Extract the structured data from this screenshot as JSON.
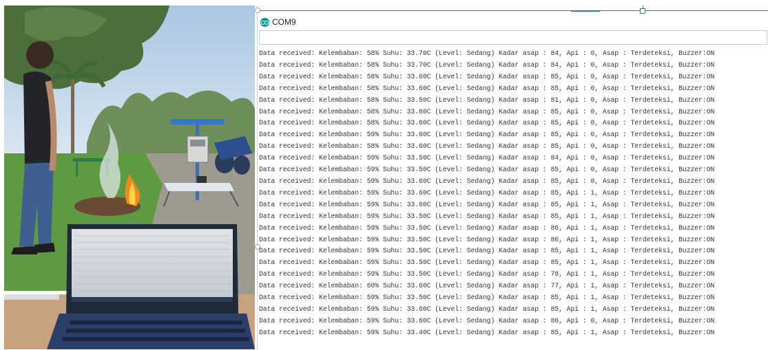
{
  "window": {
    "title": "COM9",
    "app_icon": "arduino-infinity-icon",
    "accent_color": "#00979d"
  },
  "send_input": {
    "value": "",
    "placeholder": ""
  },
  "serial_output": [
    "Data received: Kelembaban: 58% Suhu: 33.70C (Level: Sedang) Kadar asap : 84, Api : 0, Asap : Terdeteksi, Buzzer:ON",
    "Data received: Kelembaban: 58% Suhu: 33.70C (Level: Sedang) Kadar asap : 84, Api : 0, Asap : Terdeteksi, Buzzer:ON",
    "Data received: Kelembaban: 58% Suhu: 33.60C (Level: Sedang) Kadar asap : 85, Api : 0, Asap : Terdeteksi, Buzzer:ON",
    "Data received: Kelembaban: 58% Suhu: 33.60C (Level: Sedang) Kadar asap : 85, Api : 0, Asap : Terdeteksi, Buzzer:ON",
    "Data received: Kelembaban: 58% Suhu: 33.50C (Level: Sedang) Kadar asap : 81, Api : 0, Asap : Terdeteksi, Buzzer:ON",
    "Data received: Kelembaban: 58% Suhu: 33.60C (Level: Sedang) Kadar asap : 85, Api : 0, Asap : Terdeteksi, Buzzer:ON",
    "Data received: Kelembaban: 58% Suhu: 33.60C (Level: Sedang) Kadar asap : 85, Api : 0, Asap : Terdeteksi, Buzzer:ON",
    "Data received: Kelembaban: 59% Suhu: 33.60C (Level: Sedang) Kadar asap : 85, Api : 0, Asap : Terdeteksi, Buzzer:ON",
    "Data received: Kelembaban: 58% Suhu: 33.60C (Level: Sedang) Kadar asap : 85, Api : 0, Asap : Terdeteksi, Buzzer:ON",
    "Data received: Kelembaban: 59% Suhu: 33.50C (Level: Sedang) Kadar asap : 84, Api : 0, Asap : Terdeteksi, Buzzer:ON",
    "Data received: Kelembaban: 59% Suhu: 33.50C (Level: Sedang) Kadar asap : 85, Api : 0, Asap : Terdeteksi, Buzzer:ON",
    "Data received: Kelembaban: 59% Suhu: 33.60C (Level: Sedang) Kadar asap : 85, Api : 0, Asap : Terdeteksi, Buzzer:ON",
    "Data received: Kelembaban: 59% Suhu: 33.60C (Level: Sedang) Kadar asap : 85, Api : 1, Asap : Terdeteksi, Buzzer:ON",
    "Data received: Kelembaban: 59% Suhu: 33.60C (Level: Sedang) Kadar asap : 85, Api : 1, Asap : Terdeteksi, Buzzer:ON",
    "Data received: Kelembaban: 59% Suhu: 33.50C (Level: Sedang) Kadar asap : 85, Api : 1, Asap : Terdeteksi, Buzzer:ON",
    "Data received: Kelembaban: 59% Suhu: 33.50C (Level: Sedang) Kadar asap : 86, Api : 1, Asap : Terdeteksi, Buzzer:ON",
    "Data received: Kelembaban: 59% Suhu: 33.50C (Level: Sedang) Kadar asap : 86, Api : 1, Asap : Terdeteksi, Buzzer:ON",
    "Data received: Kelembaban: 59% Suhu: 33.50C (Level: Sedang) Kadar asap : 85, Api : 1, Asap : Terdeteksi, Buzzer:ON",
    "Data received: Kelembaban: 59% Suhu: 33.50C (Level: Sedang) Kadar asap : 85, Api : 1, Asap : Terdeteksi, Buzzer:ON",
    "Data received: Kelembaban: 59% Suhu: 33.50C (Level: Sedang) Kadar asap : 78, Api : 1, Asap : Terdeteksi, Buzzer:ON",
    "Data received: Kelembaban: 60% Suhu: 33.60C (Level: Sedang) Kadar asap : 77, Api : 1, Asap : Terdeteksi, Buzzer:ON",
    "Data received: Kelembaban: 59% Suhu: 33.50C (Level: Sedang) Kadar asap : 85, Api : 1, Asap : Terdeteksi, Buzzer:ON",
    "Data received: Kelembaban: 59% Suhu: 33.60C (Level: Sedang) Kadar asap : 85, Api : 1, Asap : Terdeteksi, Buzzer:ON",
    "Data received: Kelembaban: 59% Suhu: 33.60C (Level: Sedang) Kadar asap : 86, Api : 0, Asap : Terdeteksi, Buzzer:ON",
    "Data received: Kelembaban: 59% Suhu: 33.40C (Level: Sedang) Kadar asap : 85, Api : 1, Asap : Terdeteksi, Buzzer:ON"
  ]
}
